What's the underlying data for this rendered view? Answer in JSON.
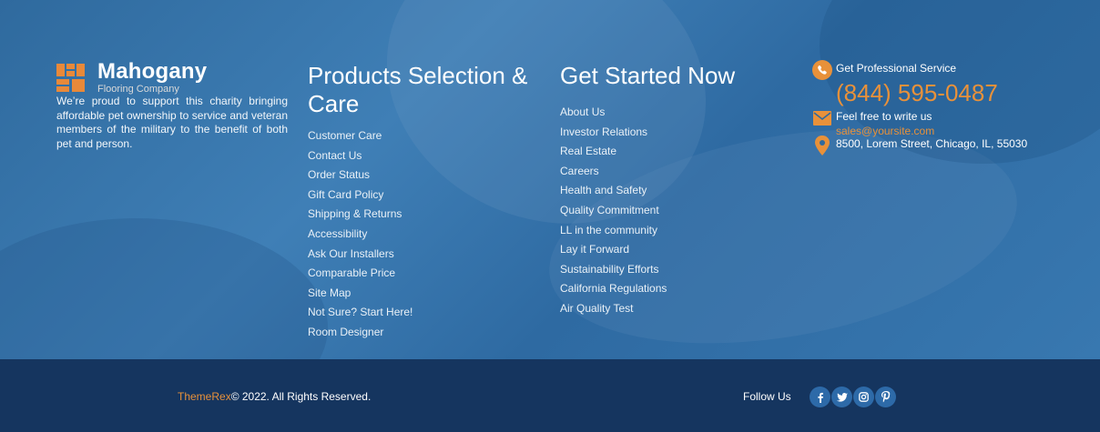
{
  "brand": {
    "name": "Mahogany",
    "tagline": "Flooring Company",
    "about": "We’re proud to support this charity bringing affordable pet ownership to service and veteran members of the military to the benefit of both pet and person."
  },
  "products": {
    "heading": "Products Selection & Care",
    "links": [
      "Customer Care",
      "Contact Us",
      "Order Status",
      "Gift Card Policy",
      "Shipping & Returns",
      "Accessibility",
      "Ask Our Installers",
      "Comparable Price",
      "Site Map",
      "Not Sure? Start Here!",
      "Room Designer"
    ]
  },
  "started": {
    "heading": "Get Started Now",
    "links": [
      "About Us",
      "Investor Relations",
      "Real Estate",
      "Careers",
      "Health and Safety",
      "Quality Commitment",
      "LL in the community",
      "Lay it Forward",
      "Sustainability Efforts",
      "California Regulations",
      "Air Quality Test"
    ]
  },
  "contact": {
    "service_label": "Get Professional Service",
    "phone": "(844) 595-0487",
    "write_label": "Feel free to write us",
    "email": "sales@yoursite.com",
    "address": "8500, Lorem Street, Chicago, IL, 55030",
    "icons": [
      "phone-icon",
      "mail-icon",
      "location-pin-icon"
    ]
  },
  "bottom": {
    "brand_link": "ThemeRex",
    "copyright": "© 2022. All Rights Reserved.",
    "follow_label": "Follow Us",
    "socials": [
      "facebook-icon",
      "twitter-icon",
      "instagram-icon",
      "pinterest-icon"
    ]
  },
  "colors": {
    "accent": "#e8913a",
    "footer_bottom_bg": "#15355f",
    "footer_top_bg": "#3374ad",
    "social_bg": "#2d6aa8"
  }
}
